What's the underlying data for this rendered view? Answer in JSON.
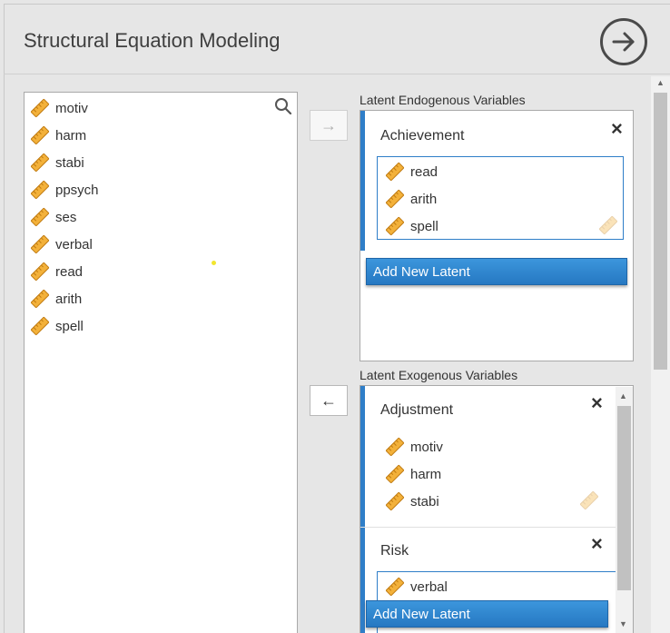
{
  "header": {
    "title": "Structural Equation Modeling",
    "go_icon": "arrow-circle-right-icon"
  },
  "variables": {
    "items": [
      {
        "label": "motiv",
        "icon": "ruler-icon"
      },
      {
        "label": "harm",
        "icon": "ruler-icon"
      },
      {
        "label": "stabi",
        "icon": "ruler-icon"
      },
      {
        "label": "ppsych",
        "icon": "ruler-icon"
      },
      {
        "label": "ses",
        "icon": "ruler-icon"
      },
      {
        "label": "verbal",
        "icon": "ruler-icon"
      },
      {
        "label": "read",
        "icon": "ruler-icon"
      },
      {
        "label": "arith",
        "icon": "ruler-icon"
      },
      {
        "label": "spell",
        "icon": "ruler-icon"
      }
    ]
  },
  "transfer": {
    "to_endogenous": "→",
    "from_exogenous": "←"
  },
  "endogenous": {
    "label": "Latent Endogenous Variables",
    "latents": [
      {
        "name": "Achievement",
        "indicators": [
          "read",
          "arith",
          "spell"
        ]
      }
    ],
    "add_label": "Add New Latent"
  },
  "exogenous": {
    "label": "Latent Exogenous Variables",
    "latents": [
      {
        "name": "Adjustment",
        "indicators": [
          "motiv",
          "harm",
          "stabi"
        ]
      },
      {
        "name": "Risk",
        "indicators": [
          "verbal"
        ]
      }
    ],
    "add_label": "Add New Latent"
  },
  "icons": {
    "close": "×",
    "accent": "#2f7ec8",
    "ruler_color": "#f0a830"
  }
}
